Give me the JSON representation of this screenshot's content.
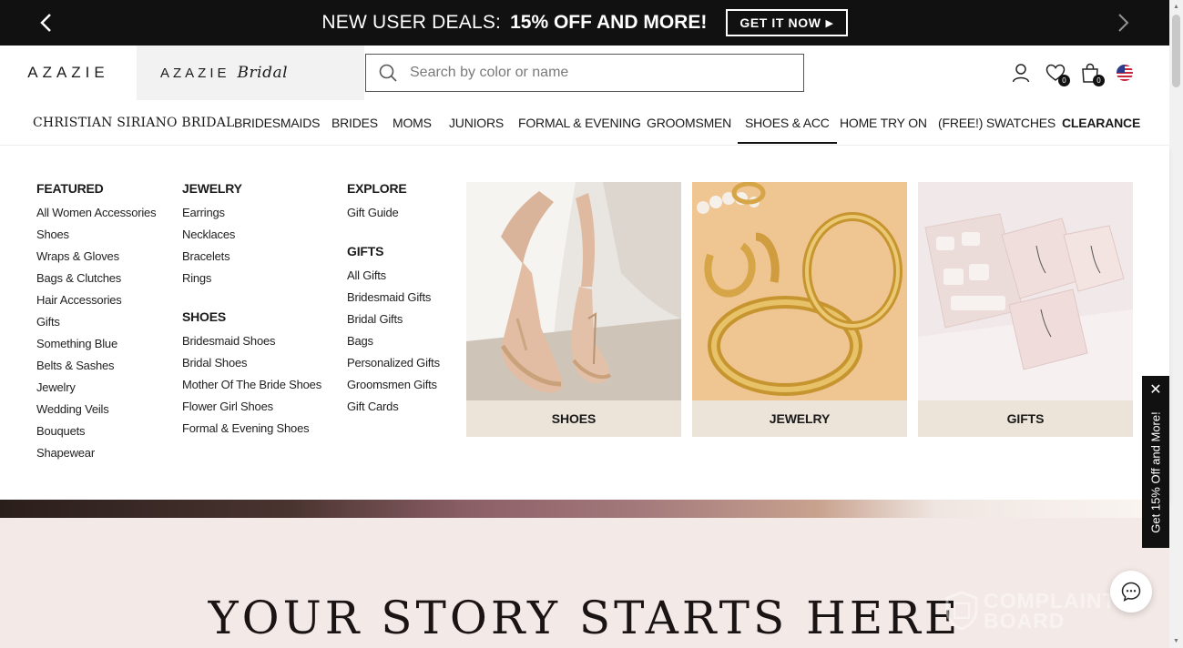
{
  "promo": {
    "lead": "NEW USER DEALS:",
    "highlight": "15% OFF AND MORE!",
    "cta": "GET IT NOW"
  },
  "header": {
    "logo": "AZAZIE",
    "bridal_logo": "AZAZIE",
    "bridal_script": "Bridal",
    "search_placeholder": "Search by color or name",
    "wishlist_count": "0",
    "cart_count": "0"
  },
  "nav": {
    "items": [
      "CHRISTIAN SIRIANO BRIDAL",
      "BRIDESMAIDS",
      "BRIDES",
      "MOMS",
      "JUNIORS",
      "FORMAL & EVENING",
      "GROOMSMEN",
      "SHOES & ACC",
      "HOME TRY ON",
      "(FREE!) SWATCHES",
      "CLEARANCE"
    ],
    "active": "SHOES & ACC"
  },
  "menu": {
    "featured": {
      "title": "FEATURED",
      "links": [
        "All Women Accessories",
        "Shoes",
        "Wraps & Gloves",
        "Bags & Clutches",
        "Hair Accessories",
        "Gifts",
        "Something Blue",
        "Belts & Sashes",
        "Jewelry",
        "Wedding Veils",
        "Bouquets",
        "Shapewear"
      ]
    },
    "jewelry": {
      "title": "JEWELRY",
      "links": [
        "Earrings",
        "Necklaces",
        "Bracelets",
        "Rings"
      ]
    },
    "shoes": {
      "title": "SHOES",
      "links": [
        "Bridesmaid Shoes",
        "Bridal Shoes",
        "Mother Of The Bride Shoes",
        "Flower Girl Shoes",
        "Formal & Evening Shoes"
      ]
    },
    "explore": {
      "title": "EXPLORE",
      "links": [
        "Gift Guide"
      ]
    },
    "gifts": {
      "title": "GIFTS",
      "links": [
        "All Gifts",
        "Bridesmaid Gifts",
        "Bridal Gifts",
        "Bags",
        "Personalized Gifts",
        "Groomsmen Gifts",
        "Gift Cards"
      ]
    },
    "tiles": [
      "SHOES",
      "JEWELRY",
      "GIFTS"
    ]
  },
  "hero": {
    "title": "YOUR STORY STARTS HERE"
  },
  "sidetab": {
    "label": "Get 15% Off and More!"
  },
  "watermark": {
    "line1": "COMPLAINTS",
    "line2": "BOARD"
  },
  "colors": {
    "promo_bg": "#111111",
    "tile_caption_bg": "#ece3d9",
    "hero_bg": "#f3e9e6"
  }
}
